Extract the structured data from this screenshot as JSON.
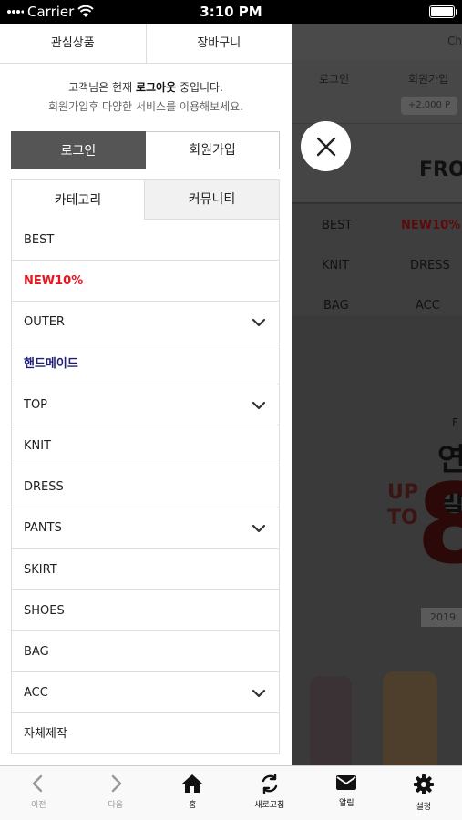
{
  "status_bar": {
    "carrier": "Carrier",
    "time": "3:10 PM"
  },
  "background": {
    "top_right_text": "Ch",
    "login": "로그인",
    "join": "회원가입",
    "pill": "+2,000 P",
    "brand": "FRO",
    "menu": [
      {
        "label": "BEST",
        "color": "#111111"
      },
      {
        "label": "NEW10%",
        "color": "#5a0b0b"
      },
      {
        "label": "KNIT",
        "color": "#111111"
      },
      {
        "label": "DRESS",
        "color": "#111111"
      },
      {
        "label": "BAG",
        "color": "#111111"
      },
      {
        "label": "ACC",
        "color": "#111111"
      }
    ],
    "banner": {
      "f": "F",
      "big": "연말",
      "upto1": "UP",
      "upto2": "TO",
      "eight": "8",
      "year": "2019."
    }
  },
  "drawer": {
    "tabs": {
      "wishlist": "관심상품",
      "cart": "장바구니"
    },
    "message": {
      "prefix": "고객님은 현재 ",
      "state": "로그아웃",
      "suffix": " 중입니다.",
      "sub": "회원가입후 다양한 서비스를 이용해보세요."
    },
    "auth": {
      "login": "로그인",
      "join": "회원가입"
    },
    "category_tabs": {
      "category": "카테고리",
      "community": "커뮤니티"
    },
    "categories": [
      {
        "label": "BEST",
        "style": "normal",
        "expandable": false
      },
      {
        "label": "NEW10%",
        "style": "red",
        "expandable": false
      },
      {
        "label": "OUTER",
        "style": "normal",
        "expandable": true
      },
      {
        "label": "핸드메이드",
        "style": "navy",
        "expandable": false
      },
      {
        "label": "TOP",
        "style": "normal",
        "expandable": true
      },
      {
        "label": "KNIT",
        "style": "normal",
        "expandable": false
      },
      {
        "label": "DRESS",
        "style": "normal",
        "expandable": false
      },
      {
        "label": "PANTS",
        "style": "normal",
        "expandable": true
      },
      {
        "label": "SKIRT",
        "style": "normal",
        "expandable": false
      },
      {
        "label": "SHOES",
        "style": "normal",
        "expandable": false
      },
      {
        "label": "BAG",
        "style": "normal",
        "expandable": false
      },
      {
        "label": "ACC",
        "style": "normal",
        "expandable": true
      },
      {
        "label": "자체제작",
        "style": "normal",
        "expandable": false
      }
    ]
  },
  "bottom_bar": {
    "prev": "이전",
    "next": "다음",
    "home": "홈",
    "refresh": "새로고침",
    "notifications": "알림",
    "settings": "설정"
  },
  "colors": {
    "accent_red": "#e8141e",
    "navy": "#1e1e7a",
    "login_bg": "#555555"
  }
}
